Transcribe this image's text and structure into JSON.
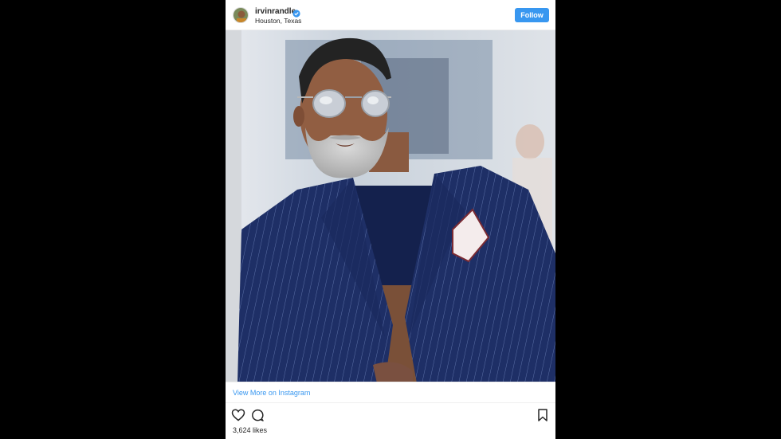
{
  "post": {
    "username": "irvinrandle",
    "location": "Houston, Texas",
    "verified": true,
    "follow_label": "Follow",
    "view_more_label": "View More on Instagram",
    "likes_text": "3,624 likes"
  },
  "icons": {
    "verified": "verified-badge-icon",
    "like": "heart-icon",
    "comment": "comment-icon",
    "save": "bookmark-icon"
  },
  "colors": {
    "accent": "#3897f0",
    "text": "#262626",
    "page_background": "#000000",
    "card_background": "#ffffff"
  }
}
